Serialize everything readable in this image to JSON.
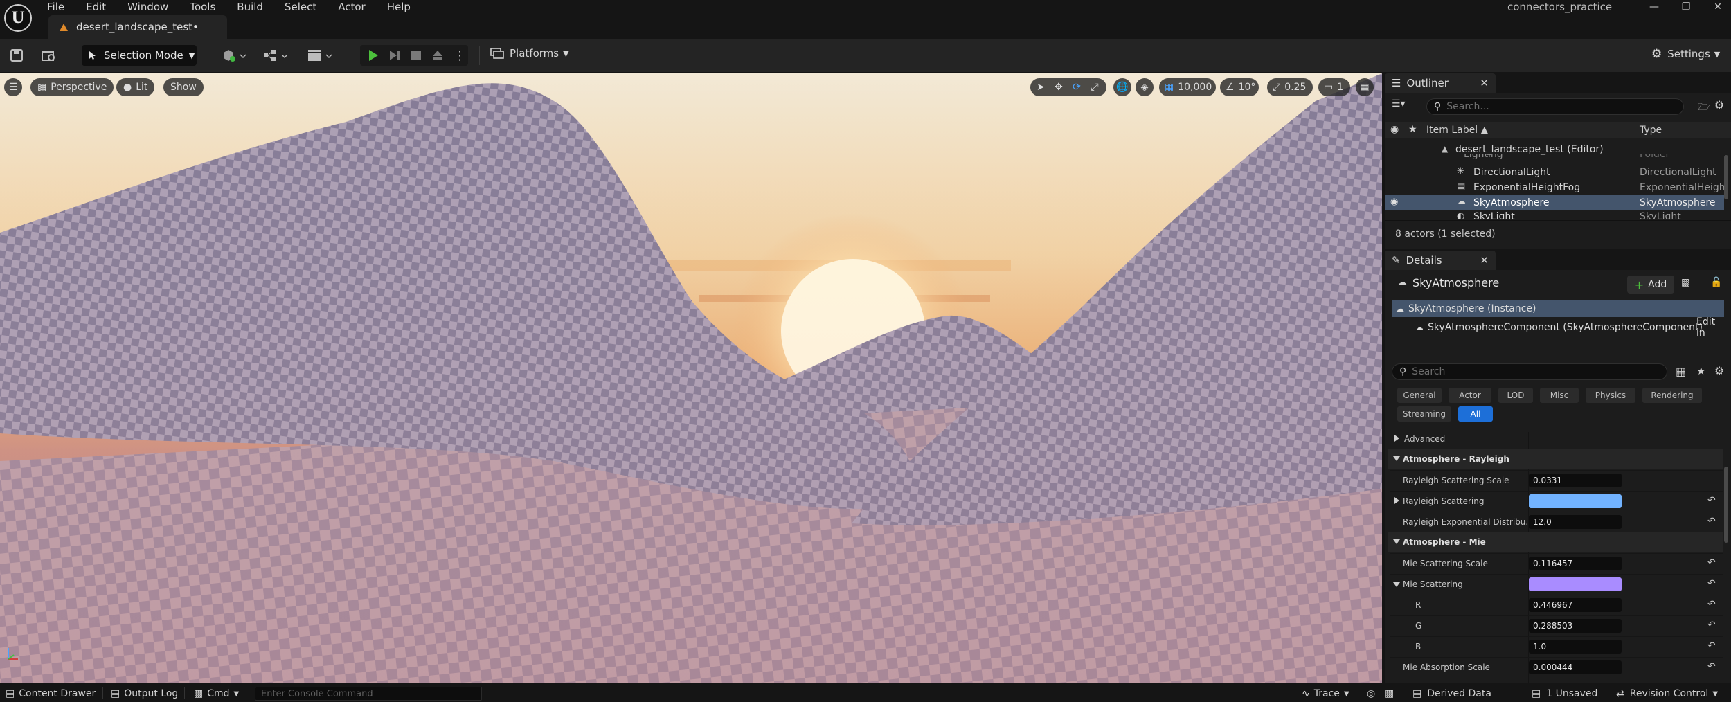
{
  "menu": [
    "File",
    "Edit",
    "Window",
    "Tools",
    "Build",
    "Select",
    "Actor",
    "Help"
  ],
  "project_name": "connectors_practice",
  "document_tab": "desert_landscape_test•",
  "toolbar": {
    "selection_mode": "Selection Mode",
    "platforms": "Platforms",
    "settings": "Settings"
  },
  "viewport": {
    "perspective": "Perspective",
    "lit": "Lit",
    "show": "Show",
    "grid_snap": "10,000",
    "rotation_snap": "10°",
    "scale_snap": "0.25",
    "camera_speed": "1"
  },
  "outliner": {
    "tab": "Outliner",
    "search_placeholder": "Search...",
    "col_label": "Item Label ▲",
    "col_type": "Type",
    "rows": [
      {
        "label": "desert_landscape_test (Editor)",
        "type": ""
      },
      {
        "label": "Lighting",
        "type": "Folder"
      },
      {
        "label": "DirectionalLight",
        "type": "DirectionalLight"
      },
      {
        "label": "ExponentialHeightFog",
        "type": "ExponentialHeigh"
      },
      {
        "label": "SkyAtmosphere",
        "type": "SkyAtmosphere"
      },
      {
        "label": "SkyLight",
        "type": "SkyLight"
      }
    ],
    "status": "8 actors (1 selected)"
  },
  "details": {
    "tab": "Details",
    "actor_name": "SkyAtmosphere",
    "add_label": "Add",
    "instance": "SkyAtmosphere (Instance)",
    "component": "SkyAtmosphereComponent (SkyAtmosphereComponent)",
    "edit_in": "Edit in",
    "search_placeholder": "Search",
    "filters": [
      "General",
      "Actor",
      "LOD",
      "Misc",
      "Physics",
      "Rendering",
      "Streaming",
      "All"
    ],
    "active_filter": "All",
    "advanced": "Advanced",
    "cat_rayleigh": "Atmosphere - Rayleigh",
    "rayleigh_scale_label": "Rayleigh Scattering Scale",
    "rayleigh_scale": "0.0331",
    "rayleigh_scattering_label": "Rayleigh Scattering",
    "rayleigh_color": "#72b3ff",
    "rayleigh_exp_label": "Rayleigh Exponential Distribu...",
    "rayleigh_exp": "12.0",
    "cat_mie": "Atmosphere - Mie",
    "mie_scale_label": "Mie Scattering Scale",
    "mie_scale": "0.116457",
    "mie_scattering_label": "Mie Scattering",
    "mie_color": "#a98cff",
    "r_label": "R",
    "r_value": "0.446967",
    "g_label": "G",
    "g_value": "0.288503",
    "b_label": "B",
    "b_value": "1.0",
    "mie_abs_label": "Mie Absorption Scale",
    "mie_abs": "0.000444"
  },
  "statusbar": {
    "content_drawer": "Content Drawer",
    "output_log": "Output Log",
    "cmd": "Cmd",
    "console_placeholder": "Enter Console Command",
    "trace": "Trace",
    "derived_data": "Derived Data",
    "unsaved": "1 Unsaved",
    "revision_control": "Revision Control"
  }
}
